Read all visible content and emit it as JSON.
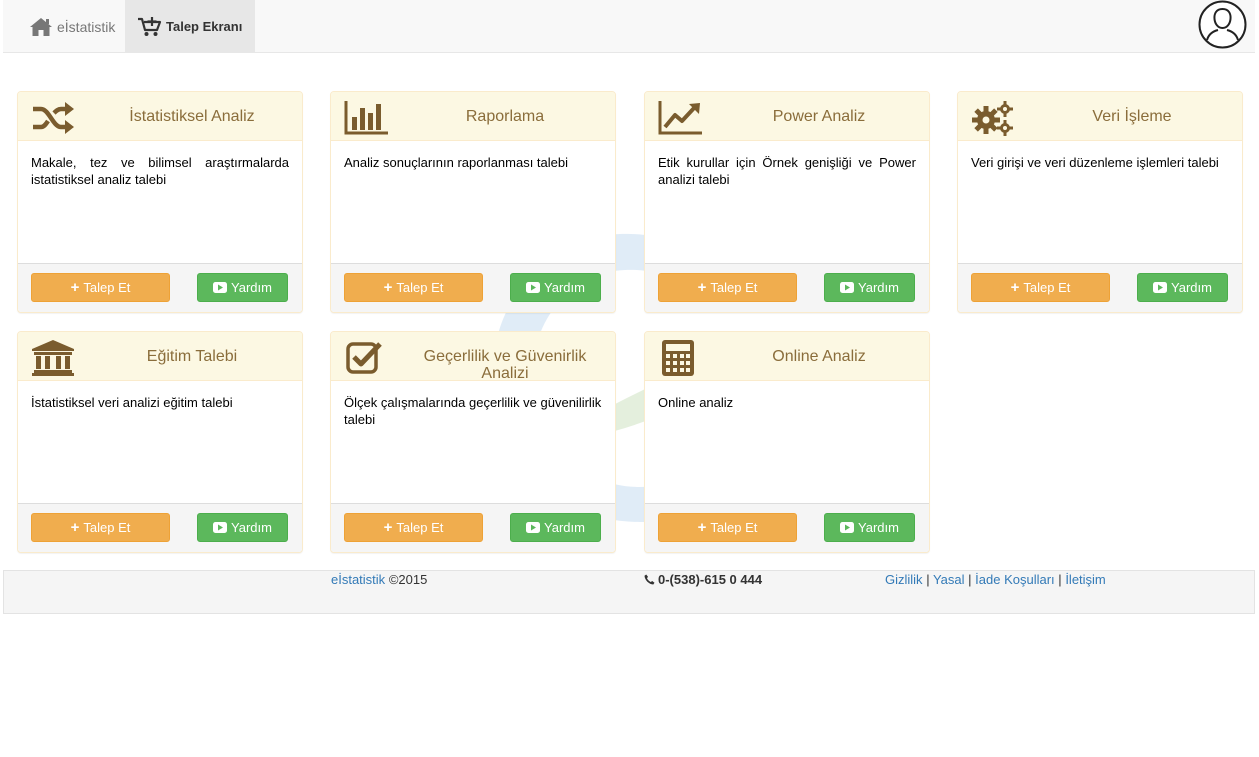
{
  "navbar": {
    "brand": "eİstatistik",
    "active_tab": "Talep Ekranı"
  },
  "cards": [
    {
      "title": "İstatistiksel Analiz",
      "icon": "shuffle-icon",
      "desc": "Makale, tez ve bilimsel araştırmalarda istatistiksel analiz talebi",
      "request": "Talep Et",
      "help": "Yardım"
    },
    {
      "title": "Raporlama",
      "icon": "bar-chart-icon",
      "desc": "Analiz sonuçlarının raporlanması talebi",
      "request": "Talep Et",
      "help": "Yardım"
    },
    {
      "title": "Power Analiz",
      "icon": "line-chart-icon",
      "desc": "Etik kurullar için Örnek genişliği ve Power analizi talebi",
      "request": "Talep Et",
      "help": "Yardım"
    },
    {
      "title": "Veri İşleme",
      "icon": "gears-icon",
      "desc": "Veri girişi ve veri düzenleme işlemleri talebi",
      "request": "Talep Et",
      "help": "Yardım"
    },
    {
      "title": "Eğitim Talebi",
      "icon": "bank-icon",
      "desc": "İstatistiksel veri analizi eğitim talebi",
      "request": "Talep Et",
      "help": "Yardım"
    },
    {
      "title": "Geçerlilik ve Güvenirlik Analizi",
      "icon": "check-square-icon",
      "desc": "Ölçek çalışmalarında geçerlilik ve güvenilirlik talebi",
      "request": "Talep Et",
      "help": "Yardım"
    },
    {
      "title": "Online Analiz",
      "icon": "calculator-icon",
      "desc": "Online analiz",
      "request": "Talep Et",
      "help": "Yardım"
    }
  ],
  "footer": {
    "brand": "eİstatistik",
    "copyright": "©2015",
    "phone": "0-(538)-615 0 444",
    "links": [
      "Gizlilik",
      "Yasal",
      "İade Koşulları",
      "İletişim"
    ],
    "separator": "|"
  },
  "colors": {
    "warning": "#f0ad4e",
    "success": "#5cb85c",
    "panel_heading": "#fcf8e3",
    "panel_title": "#8a6d3b",
    "icon_brown": "#7a5c2e",
    "link": "#337ab7"
  }
}
